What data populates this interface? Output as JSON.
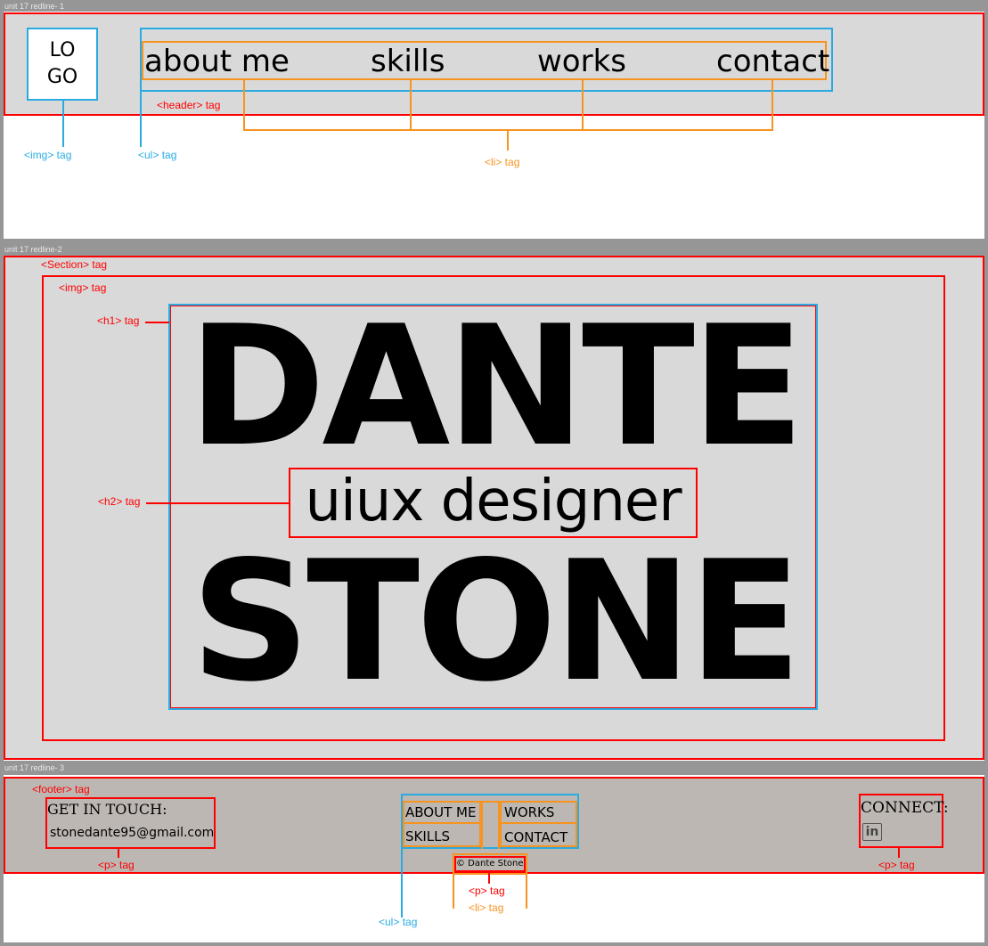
{
  "frames": [
    {
      "label": "unit 17 redline- 1"
    },
    {
      "label": "unit 17 redline-2"
    },
    {
      "label": "unit 17 redline- 3"
    }
  ],
  "header": {
    "logo_line1": "LO",
    "logo_line2": "GO",
    "nav": [
      "about me",
      "skills",
      "works",
      "contact"
    ],
    "annotations": {
      "header": "<header> tag",
      "img": "<img> tag",
      "ul": "<ul> tag",
      "li": "<li> tag"
    }
  },
  "hero": {
    "h1_top": "DANTE",
    "h2": "uiux designer",
    "h1_bottom": "STONE",
    "annotations": {
      "section": "<Section> tag",
      "img": "<img> tag",
      "h1": "<h1> tag",
      "h2": "<h2> tag"
    }
  },
  "footer": {
    "get_in_touch": "GET IN TOUCH:",
    "email": "stonedante95@gmail.com",
    "nav": [
      "ABOUT ME",
      "WORKS",
      "SKILLS",
      "CONTACT"
    ],
    "copyright": "© Dante Stone",
    "connect": "CONNECT:",
    "linkedin_glyph": "in",
    "annotations": {
      "footer": "<footer> tag",
      "p_left": "<p> tag",
      "p_center": "<p> tag",
      "li": "<li> tag",
      "ul": "<ul> tag",
      "p_right": "<p> tag"
    }
  },
  "colors": {
    "red": "#ff0000",
    "blue": "#29abe2",
    "orange": "#f7931e",
    "panel_gray": "#d9d9d9",
    "footer_gray": "#bcb7b3",
    "canvas": "#969696"
  }
}
